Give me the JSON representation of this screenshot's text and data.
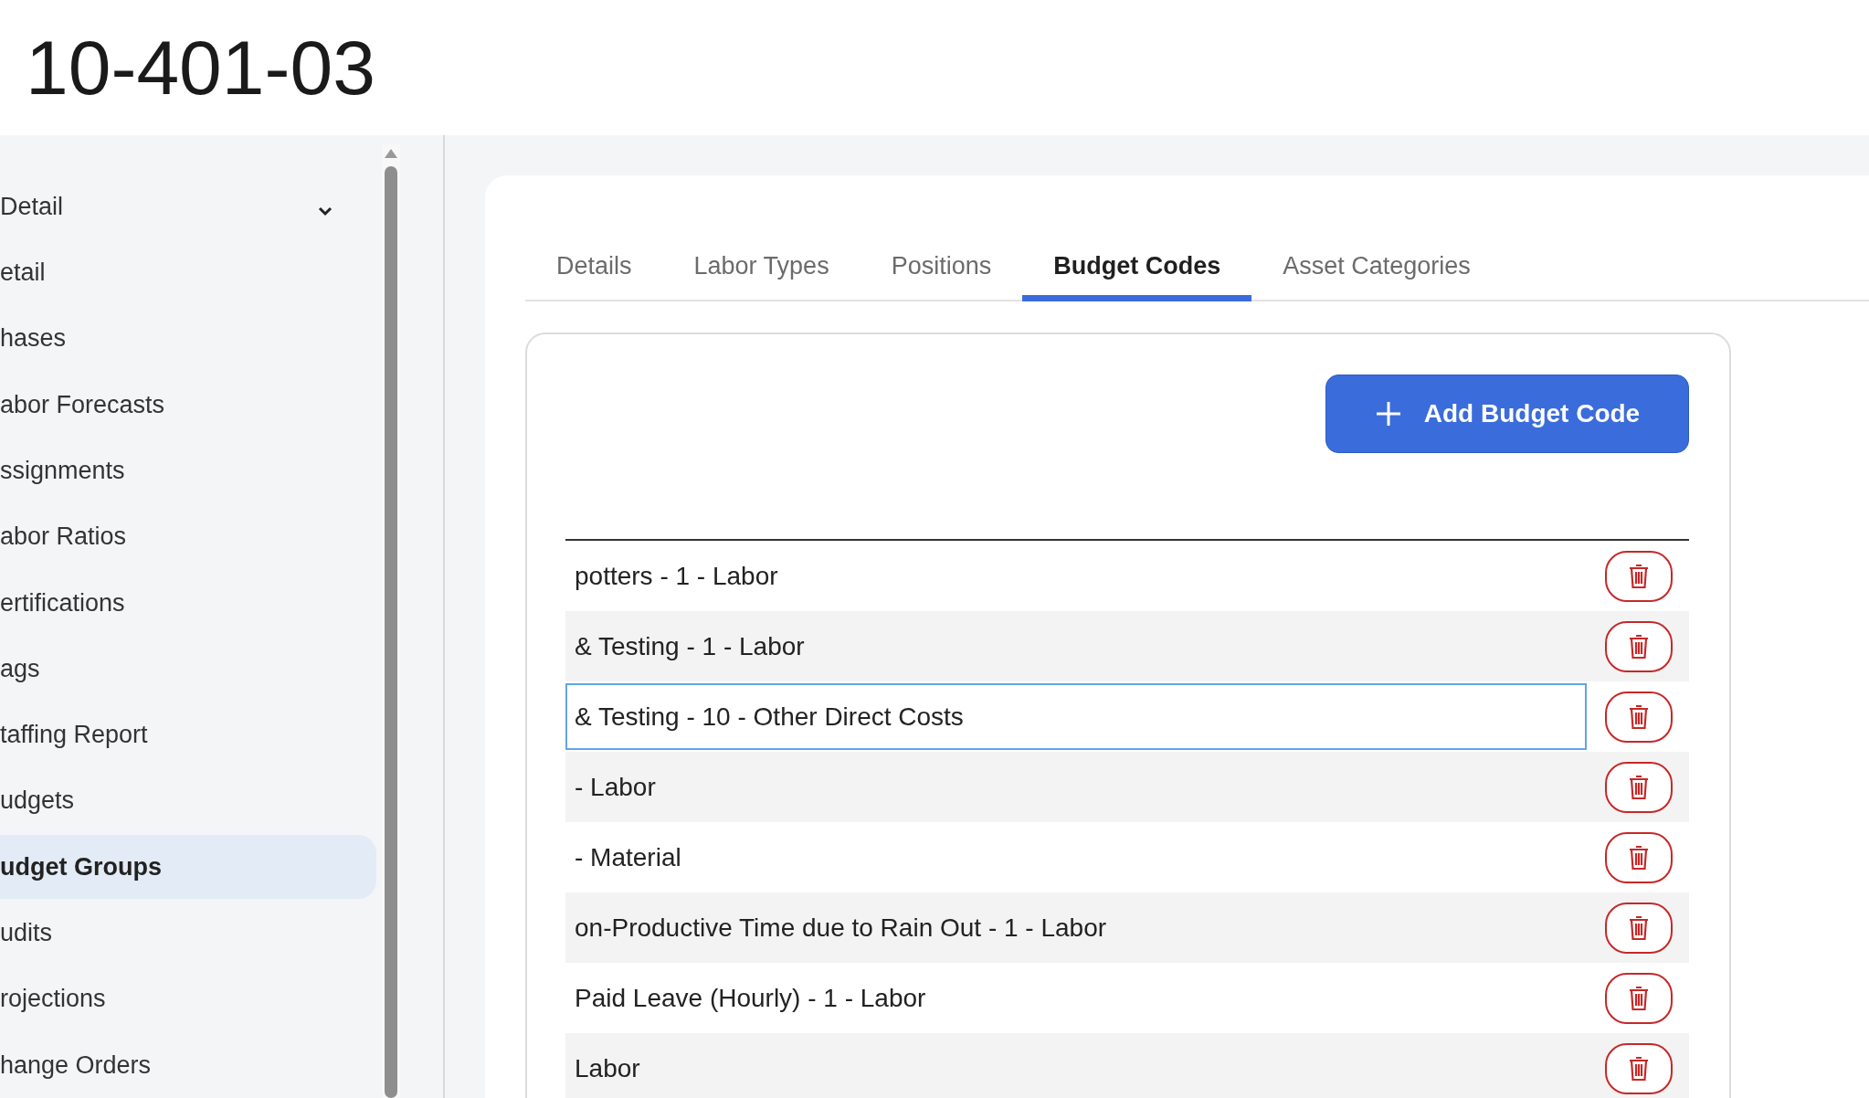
{
  "page_title": "10-401-03",
  "sidebar": {
    "items": [
      {
        "label": "Detail",
        "selected": false,
        "expandable": true
      },
      {
        "label": "etail",
        "selected": false
      },
      {
        "label": "hases",
        "selected": false
      },
      {
        "label": "abor Forecasts",
        "selected": false
      },
      {
        "label": "ssignments",
        "selected": false
      },
      {
        "label": "abor Ratios",
        "selected": false
      },
      {
        "label": "ertifications",
        "selected": false
      },
      {
        "label": "ags",
        "selected": false
      },
      {
        "label": "taffing Report",
        "selected": false
      },
      {
        "label": "udgets",
        "selected": false
      },
      {
        "label": "udget Groups",
        "selected": true
      },
      {
        "label": "udits",
        "selected": false
      },
      {
        "label": "rojections",
        "selected": false
      },
      {
        "label": "hange Orders",
        "selected": false
      }
    ]
  },
  "tabs": [
    {
      "label": "Details",
      "selected": false
    },
    {
      "label": "Labor Types",
      "selected": false
    },
    {
      "label": "Positions",
      "selected": false
    },
    {
      "label": "Budget Codes",
      "selected": true
    },
    {
      "label": "Asset Categories",
      "selected": false
    }
  ],
  "add_button": {
    "label": "Add Budget Code"
  },
  "rows": [
    {
      "text": "potters - 1 - Labor",
      "focused": false
    },
    {
      "text": "& Testing - 1 - Labor",
      "focused": false
    },
    {
      "text": "& Testing - 10 - Other Direct Costs",
      "focused": true
    },
    {
      "text": "- Labor",
      "focused": false
    },
    {
      "text": "- Material",
      "focused": false
    },
    {
      "text": "on-Productive Time due to Rain Out - 1 - Labor",
      "focused": false
    },
    {
      "text": "Paid Leave (Hourly) - 1 - Labor",
      "focused": false
    },
    {
      "text": "Labor",
      "focused": false
    }
  ]
}
